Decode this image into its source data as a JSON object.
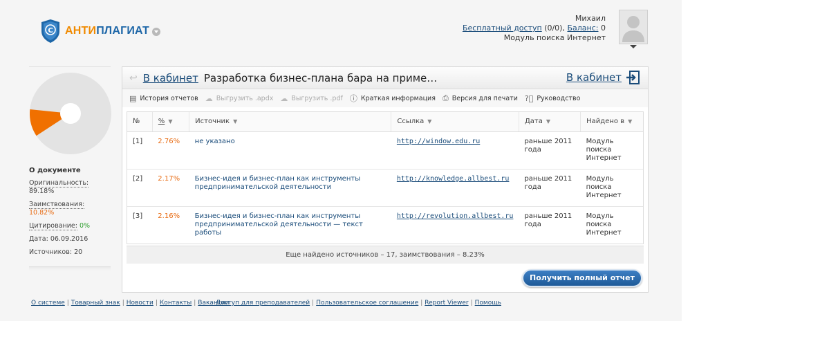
{
  "logo": {
    "part1": "АНТИ",
    "part2": "ПЛАГИАТ"
  },
  "user": {
    "name": "Михаил",
    "free_access_label": "Бесплатный доступ",
    "free_access_value": "(0/0)",
    "balance_label": "Баланс:",
    "balance_value": "0",
    "module": "Модуль поиска Интернет"
  },
  "left": {
    "pie": {
      "originality": 89.18,
      "borrowing": 10.82,
      "citation": 0
    },
    "about_title": "О документе",
    "originality_label": "Оригинальность:",
    "originality_value": "89.18%",
    "borrowing_label": "Заимствования:",
    "borrowing_value": "10.82%",
    "citation_label": "Цитирование:",
    "citation_value": "0%",
    "date_label": "Дата:",
    "date_value": "06.09.2016",
    "sources_label": "Источников:",
    "sources_value": "20"
  },
  "panel": {
    "cabinet_link": "В кабинет",
    "doc_title": "Разработка бизнес-плана бара на приме…",
    "cabinet_right": "В кабинет"
  },
  "toolbar": {
    "history": "История отчетов",
    "export_apdx": "Выгрузить .apdx",
    "export_pdf": "Выгрузить .pdf",
    "brief": "Краткая информация",
    "print": "Версия для печати",
    "guide": "Руководство"
  },
  "table": {
    "headers": {
      "num": "№",
      "pct": "%",
      "source": "Источник",
      "link": "Ссылка",
      "date": "Дата",
      "found": "Найдено в"
    },
    "rows": [
      {
        "num": "[1]",
        "pct": "2.76%",
        "source": "не указано",
        "link": "http://window.edu.ru",
        "date": "раньше 2011 года",
        "found": "Модуль поиска Интернет"
      },
      {
        "num": "[2]",
        "pct": "2.17%",
        "source": "Бизнес-идея и бизнес-план как инструменты предпринимательской деятельности",
        "link": "http://knowledge.allbest.ru",
        "date": "раньше 2011 года",
        "found": "Модуль поиска Интернет"
      },
      {
        "num": "[3]",
        "pct": "2.16%",
        "source": "Бизнес-идея и бизнес-план как инструменты предпринимательской деятельности — текст работы",
        "link": "http://revolution.allbest.ru",
        "date": "раньше 2011 года",
        "found": "Модуль поиска Интернет"
      }
    ],
    "more": "Еще найдено источников – 17, заимствования – 8.23%"
  },
  "full_report_button": "Получить полный отчет",
  "footer": {
    "left": [
      "О системе",
      "Товарный знак",
      "Новости",
      "Контакты",
      "Вакансии"
    ],
    "right": [
      "Доступ для преподавателей",
      "Пользовательское соглашение",
      "Report Viewer",
      "Помощь"
    ]
  },
  "colors": {
    "orange": "#f07000",
    "pie_gray": "#e3e3e3",
    "link_blue": "#1a4c7a",
    "button_blue": "#2e6db0"
  }
}
